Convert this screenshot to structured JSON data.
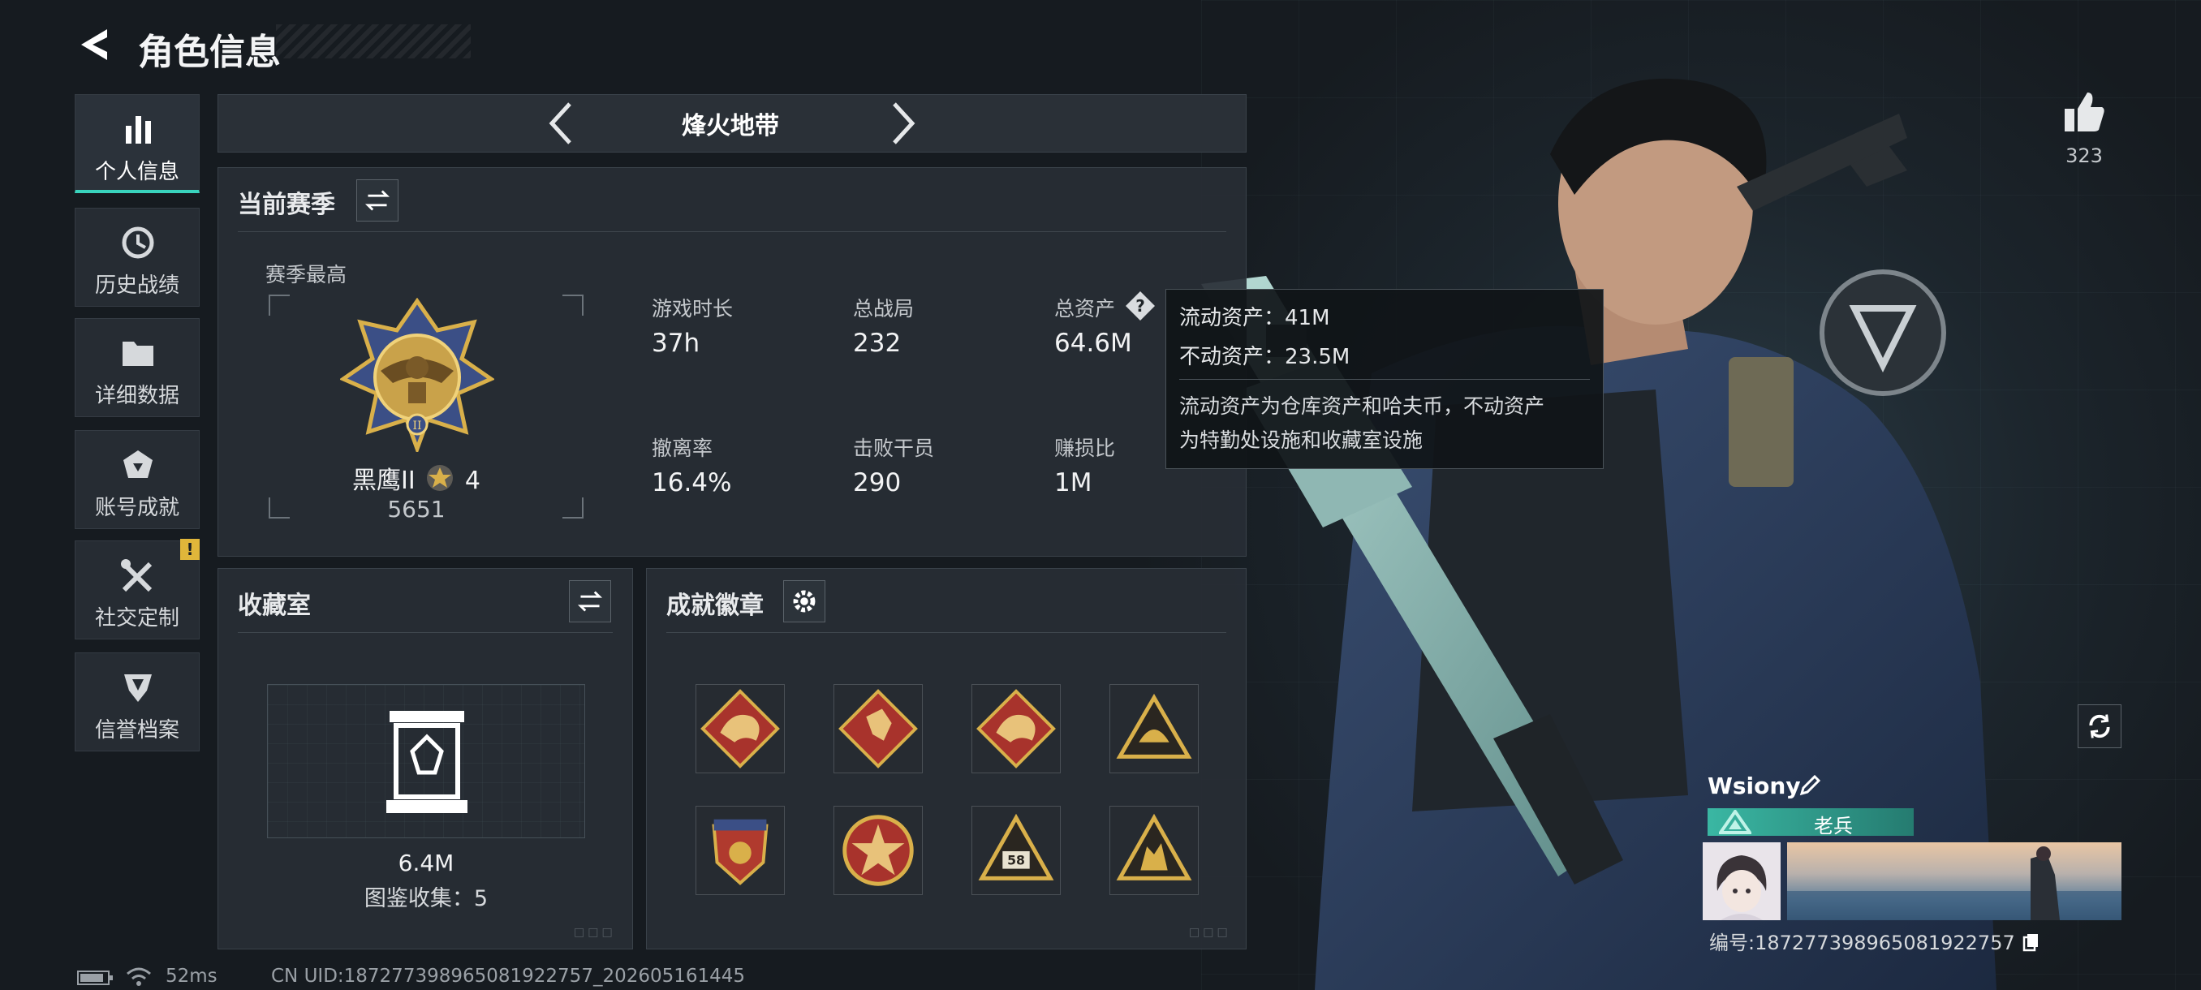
{
  "header": {
    "title": "角色信息"
  },
  "nav": [
    {
      "label": "个人信息",
      "icon": "bar-chart-icon"
    },
    {
      "label": "历史战绩",
      "icon": "history-clock-icon"
    },
    {
      "label": "详细数据",
      "icon": "folder-icon"
    },
    {
      "label": "账号成就",
      "icon": "achievement-icon"
    },
    {
      "label": "社交定制",
      "icon": "tools-icon",
      "alert": "!"
    },
    {
      "label": "信誉档案",
      "icon": "reputation-icon"
    }
  ],
  "mode_selector": {
    "label": "烽火地带"
  },
  "season": {
    "title": "当前赛季",
    "highest_label": "赛季最高",
    "rank_name": "黑鹰II",
    "rank_stars": "4",
    "rank_score": "5651",
    "stats": [
      {
        "label": "游戏时长",
        "value": "37h"
      },
      {
        "label": "总战局",
        "value": "232"
      },
      {
        "label": "总资产",
        "value": "64.6M"
      },
      {
        "label": "撤离率",
        "value": "16.4%"
      },
      {
        "label": "击败干员",
        "value": "290"
      },
      {
        "label": "赚损比",
        "value": "1M"
      }
    ]
  },
  "tooltip": {
    "line1": "流动资产：41M",
    "line2": "不动资产：23.5M",
    "desc1": "流动资产为仓库资产和哈夫币，不动资产",
    "desc2": "为特勤处设施和收藏室设施"
  },
  "collection": {
    "title": "收藏室",
    "value": "6.4M",
    "count_label": "图鉴收集：5"
  },
  "achievements": {
    "title": "成就徽章",
    "badges": [
      "dragon-badge-icon",
      "runner-badge-icon",
      "dragon-badge-icon",
      "helmet-triangle-badge-icon",
      "shield-star-badge-icon",
      "star-emblem-badge-icon",
      "number-58-badge-icon",
      "soldiers-triangle-badge-icon"
    ],
    "badge_58_text": "58"
  },
  "likes": {
    "count": "323"
  },
  "profile": {
    "name": "Wsiony",
    "title": "老兵",
    "id_label": "编号:18727739896508192​2757"
  },
  "status_bar": {
    "ping": "52ms",
    "uid": "CN UID:18727739896508192​2757_202605161445"
  },
  "colors": {
    "accent": "#39d3bd",
    "gold": "#d9b04a",
    "badge_red": "#a8332c",
    "alert": "#e0b63a"
  }
}
